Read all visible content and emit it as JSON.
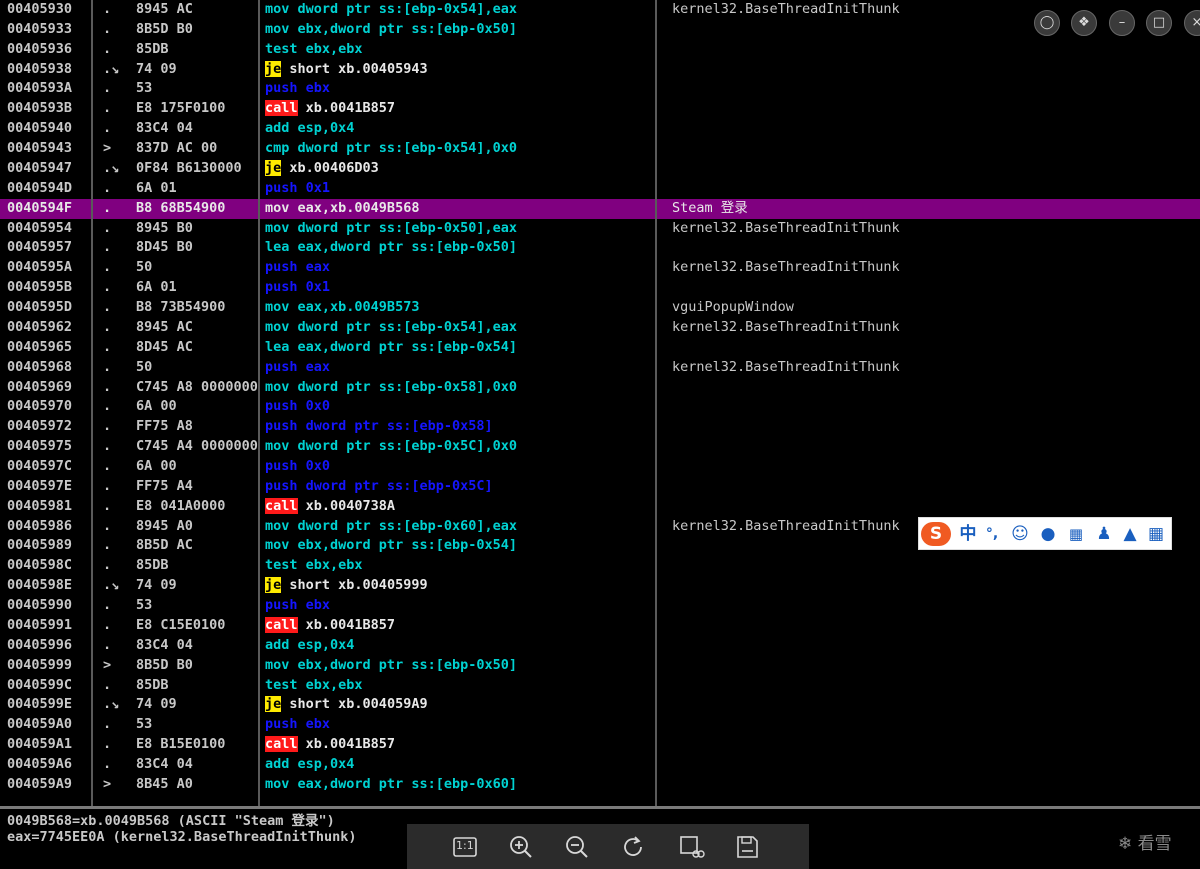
{
  "rows": [
    {
      "addr": "00405930",
      "mark": ".",
      "hex": "8945 AC",
      "op": "mov",
      "opnd": "dword ptr ss:[ebp-0x54],eax",
      "cmt": "kernel32.BaseThreadInitThunk"
    },
    {
      "addr": "00405933",
      "mark": ".",
      "hex": "8B5D B0",
      "op": "mov",
      "opnd": "ebx,dword ptr ss:[ebp-0x50]",
      "cmt": ""
    },
    {
      "addr": "00405936",
      "mark": ".",
      "hex": "85DB",
      "op": "test",
      "opnd": "ebx,ebx",
      "cmt": ""
    },
    {
      "addr": "00405938",
      "mark": ".↘",
      "hex": "74 09",
      "op": "je",
      "opnd": "short xb.00405943",
      "cmt": ""
    },
    {
      "addr": "0040593A",
      "mark": ".",
      "hex": "53",
      "op": "push",
      "opnd": "ebx",
      "cmt": ""
    },
    {
      "addr": "0040593B",
      "mark": ".",
      "hex": "E8 175F0100",
      "op": "call",
      "opnd": "xb.0041B857",
      "cmt": ""
    },
    {
      "addr": "00405940",
      "mark": ".",
      "hex": "83C4 04",
      "op": "add",
      "opnd": "esp,0x4",
      "cmt": ""
    },
    {
      "addr": "00405943",
      "mark": ">",
      "hex": "837D AC 00",
      "op": "cmp",
      "opnd": "dword ptr ss:[ebp-0x54],0x0",
      "cmt": ""
    },
    {
      "addr": "00405947",
      "mark": ".↘",
      "hex": "0F84 B6130000",
      "op": "je",
      "opnd": "xb.00406D03",
      "cmt": ""
    },
    {
      "addr": "0040594D",
      "mark": ".",
      "hex": "6A 01",
      "op": "push",
      "opnd": "0x1",
      "cmt": ""
    },
    {
      "addr": "0040594F",
      "mark": ".",
      "hex": "B8 68B54900",
      "op": "mov",
      "opnd": "eax,xb.0049B568",
      "cmt": "Steam 登录",
      "hl": true
    },
    {
      "addr": "00405954",
      "mark": ".",
      "hex": "8945 B0",
      "op": "mov",
      "opnd": "dword ptr ss:[ebp-0x50],eax",
      "cmt": "kernel32.BaseThreadInitThunk"
    },
    {
      "addr": "00405957",
      "mark": ".",
      "hex": "8D45 B0",
      "op": "lea",
      "opnd": "eax,dword ptr ss:[ebp-0x50]",
      "cmt": ""
    },
    {
      "addr": "0040595A",
      "mark": ".",
      "hex": "50",
      "op": "push",
      "opnd": "eax",
      "cmt": "kernel32.BaseThreadInitThunk"
    },
    {
      "addr": "0040595B",
      "mark": ".",
      "hex": "6A 01",
      "op": "push",
      "opnd": "0x1",
      "cmt": ""
    },
    {
      "addr": "0040595D",
      "mark": ".",
      "hex": "B8 73B54900",
      "op": "mov",
      "opnd": "eax,xb.0049B573",
      "cmt": "vguiPopupWindow"
    },
    {
      "addr": "00405962",
      "mark": ".",
      "hex": "8945 AC",
      "op": "mov",
      "opnd": "dword ptr ss:[ebp-0x54],eax",
      "cmt": "kernel32.BaseThreadInitThunk"
    },
    {
      "addr": "00405965",
      "mark": ".",
      "hex": "8D45 AC",
      "op": "lea",
      "opnd": "eax,dword ptr ss:[ebp-0x54]",
      "cmt": ""
    },
    {
      "addr": "00405968",
      "mark": ".",
      "hex": "50",
      "op": "push",
      "opnd": "eax",
      "cmt": "kernel32.BaseThreadInitThunk"
    },
    {
      "addr": "00405969",
      "mark": ".",
      "hex": "C745 A8 00000000",
      "op": "mov",
      "opnd": "dword ptr ss:[ebp-0x58],0x0",
      "cmt": ""
    },
    {
      "addr": "00405970",
      "mark": ".",
      "hex": "6A 00",
      "op": "push",
      "opnd": "0x0",
      "cmt": ""
    },
    {
      "addr": "00405972",
      "mark": ".",
      "hex": "FF75 A8",
      "op": "push",
      "opnd": "dword ptr ss:[ebp-0x58]",
      "cmt": ""
    },
    {
      "addr": "00405975",
      "mark": ".",
      "hex": "C745 A4 00000000",
      "op": "mov",
      "opnd": "dword ptr ss:[ebp-0x5C],0x0",
      "cmt": ""
    },
    {
      "addr": "0040597C",
      "mark": ".",
      "hex": "6A 00",
      "op": "push",
      "opnd": "0x0",
      "cmt": ""
    },
    {
      "addr": "0040597E",
      "mark": ".",
      "hex": "FF75 A4",
      "op": "push",
      "opnd": "dword ptr ss:[ebp-0x5C]",
      "cmt": ""
    },
    {
      "addr": "00405981",
      "mark": ".",
      "hex": "E8 041A0000",
      "op": "call",
      "opnd": "xb.0040738A",
      "cmt": ""
    },
    {
      "addr": "00405986",
      "mark": ".",
      "hex": "8945 A0",
      "op": "mov",
      "opnd": "dword ptr ss:[ebp-0x60],eax",
      "cmt": "kernel32.BaseThreadInitThunk"
    },
    {
      "addr": "00405989",
      "mark": ".",
      "hex": "8B5D AC",
      "op": "mov",
      "opnd": "ebx,dword ptr ss:[ebp-0x54]",
      "cmt": ""
    },
    {
      "addr": "0040598C",
      "mark": ".",
      "hex": "85DB",
      "op": "test",
      "opnd": "ebx,ebx",
      "cmt": ""
    },
    {
      "addr": "0040598E",
      "mark": ".↘",
      "hex": "74 09",
      "op": "je",
      "opnd": "short xb.00405999",
      "cmt": ""
    },
    {
      "addr": "00405990",
      "mark": ".",
      "hex": "53",
      "op": "push",
      "opnd": "ebx",
      "cmt": ""
    },
    {
      "addr": "00405991",
      "mark": ".",
      "hex": "E8 C15E0100",
      "op": "call",
      "opnd": "xb.0041B857",
      "cmt": ""
    },
    {
      "addr": "00405996",
      "mark": ".",
      "hex": "83C4 04",
      "op": "add",
      "opnd": "esp,0x4",
      "cmt": ""
    },
    {
      "addr": "00405999",
      "mark": ">",
      "hex": "8B5D B0",
      "op": "mov",
      "opnd": "ebx,dword ptr ss:[ebp-0x50]",
      "cmt": ""
    },
    {
      "addr": "0040599C",
      "mark": ".",
      "hex": "85DB",
      "op": "test",
      "opnd": "ebx,ebx",
      "cmt": ""
    },
    {
      "addr": "0040599E",
      "mark": ".↘",
      "hex": "74 09",
      "op": "je",
      "opnd": "short xb.004059A9",
      "cmt": ""
    },
    {
      "addr": "004059A0",
      "mark": ".",
      "hex": "53",
      "op": "push",
      "opnd": "ebx",
      "cmt": ""
    },
    {
      "addr": "004059A1",
      "mark": ".",
      "hex": "E8 B15E0100",
      "op": "call",
      "opnd": "xb.0041B857",
      "cmt": ""
    },
    {
      "addr": "004059A6",
      "mark": ".",
      "hex": "83C4 04",
      "op": "add",
      "opnd": "esp,0x4",
      "cmt": ""
    },
    {
      "addr": "004059A9",
      "mark": ">",
      "hex": "8B45 A0",
      "op": "mov",
      "opnd": "eax,dword ptr ss:[ebp-0x60]",
      "cmt": ""
    }
  ],
  "info": {
    "line1": "0049B568=xb.0049B568 (ASCII \"Steam 登录\")",
    "line2": "eax=7745EE0A (kernel32.BaseThreadInitThunk)"
  },
  "viewer_toolbar": {
    "actual_size_label": "1:1",
    "icons": [
      "zoom-in-icon",
      "zoom-out-icon",
      "rotate-icon",
      "crop-icon",
      "save-icon"
    ]
  },
  "window_controls": [
    "chat-icon",
    "skin-icon",
    "minimize-icon",
    "maximize-icon",
    "close-icon"
  ],
  "ime_bar": {
    "mode_label": "中",
    "punct_label": "°,",
    "icons": [
      "sogou-logo-icon",
      "emoji-icon",
      "mic-icon",
      "keyboard-icon",
      "user-icon",
      "shirt-icon",
      "grid-icon"
    ]
  },
  "watermark": "看雪",
  "colors": {
    "highlight_row": "#800080",
    "mnemonic": "#00d2d2",
    "push": "#1515ff",
    "je_bg": "#ffeb00",
    "call_bg": "#ff1a1a",
    "immediate": "#c8c800"
  }
}
